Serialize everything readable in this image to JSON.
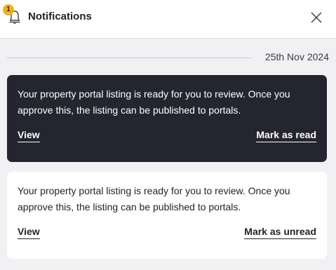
{
  "header": {
    "title": "Notifications",
    "badge_count": "1",
    "bell_icon": "bell-icon",
    "close_icon": "close-icon"
  },
  "date_group": {
    "label": "25th Nov 2024"
  },
  "notifications": [
    {
      "message": "Your property portal listing is ready for you to review. Once you approve this, the listing can be published to portals.",
      "view_label": "View",
      "toggle_label": "Mark as read",
      "state": "unread"
    },
    {
      "message": "Your property portal listing is ready for you to review. Once you approve this, the listing can be published to portals.",
      "view_label": "View",
      "toggle_label": "Mark as unread",
      "state": "read"
    }
  ],
  "colors": {
    "unread_card_bg": "#24252f",
    "read_card_bg": "#ffffff",
    "badge": "#f2b11a",
    "page_bg": "#f1f1f3"
  }
}
